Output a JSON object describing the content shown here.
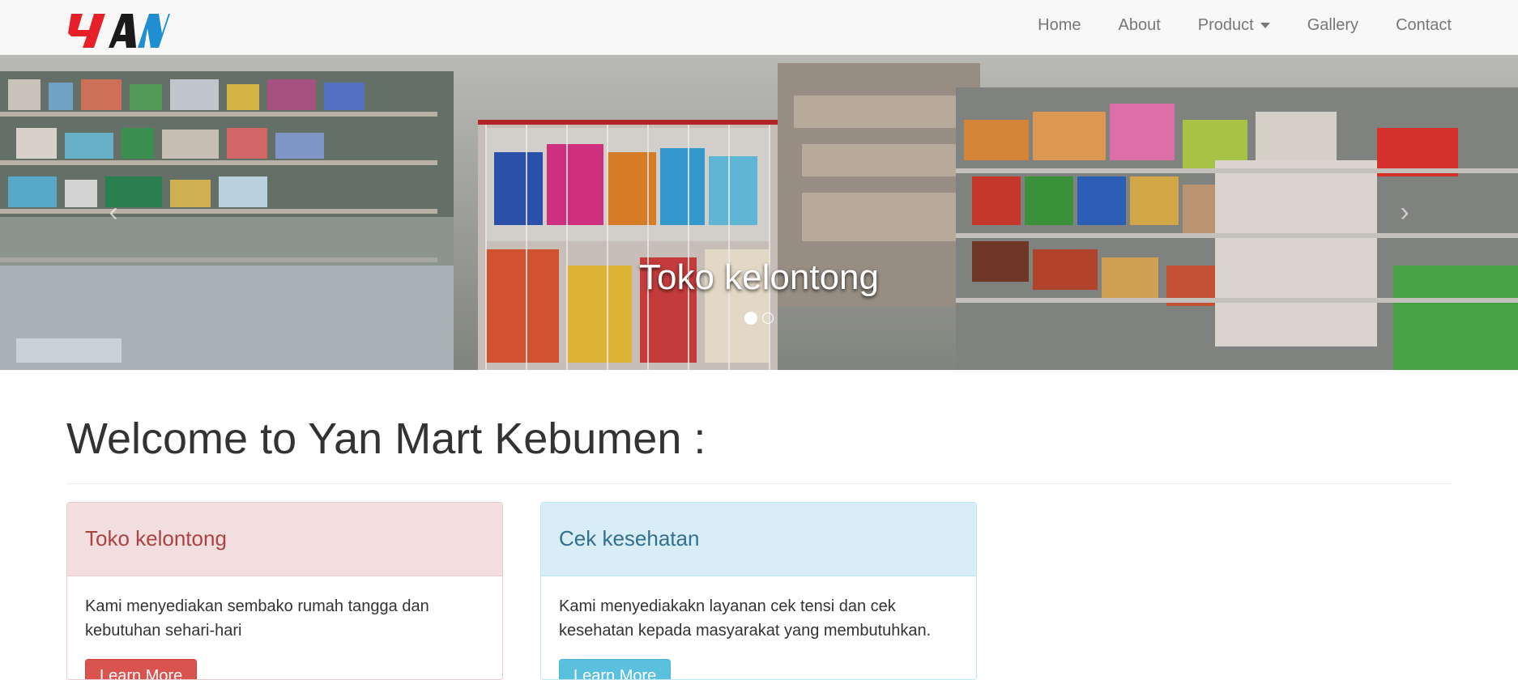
{
  "brand": {
    "logo_text": "YAN"
  },
  "nav": {
    "home": "Home",
    "about": "About",
    "product": "Product",
    "gallery": "Gallery",
    "contact": "Contact"
  },
  "carousel": {
    "caption": "Toko kelontong",
    "prev_icon": "‹",
    "next_icon": "›",
    "slides": 2,
    "active_slide": 1
  },
  "main": {
    "heading": "Welcome to Yan Mart Kebumen :",
    "panels": [
      {
        "title": "Toko kelontong",
        "body": "Kami menyediakan sembako rumah tangga dan kebutuhan sehari-hari",
        "button": "Learn More",
        "color": "#d9534f"
      },
      {
        "title": "Cek kesehatan",
        "body": "Kami menyediakakn layanan cek tensi dan cek kesehatan kepada masyarakat yang membutuhkan.",
        "button": "Learn More",
        "color": "#5bc0de"
      }
    ]
  }
}
